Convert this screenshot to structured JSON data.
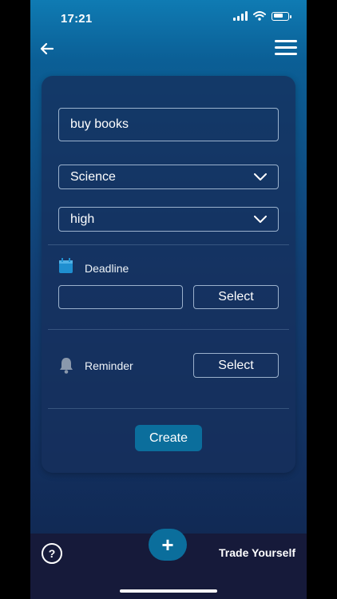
{
  "status_bar": {
    "time": "17:21"
  },
  "icons": {
    "back": "arrow-left-icon",
    "menu": "hamburger-menu-icon",
    "category_chevron": "chevron-down-icon",
    "priority_chevron": "chevron-down-icon",
    "deadline": "calendar-icon",
    "reminder": "bell-icon",
    "help": "question-circle-icon",
    "add": "plus-icon"
  },
  "form": {
    "title_value": "buy books",
    "category_value": "Science",
    "priority_value": "high",
    "deadline_label": "Deadline",
    "deadline_value": "",
    "deadline_select_label": "Select",
    "reminder_label": "Reminder",
    "reminder_select_label": "Select",
    "create_label": "Create"
  },
  "bottom_bar": {
    "help_label": "?",
    "add_label": "+",
    "brand": "Trade Yourself"
  },
  "colors": {
    "accent": "#0b6e9c",
    "gradient_top": "#0f7bb3",
    "gradient_bottom": "#10244c",
    "bottom_bar": "#161a3a"
  }
}
